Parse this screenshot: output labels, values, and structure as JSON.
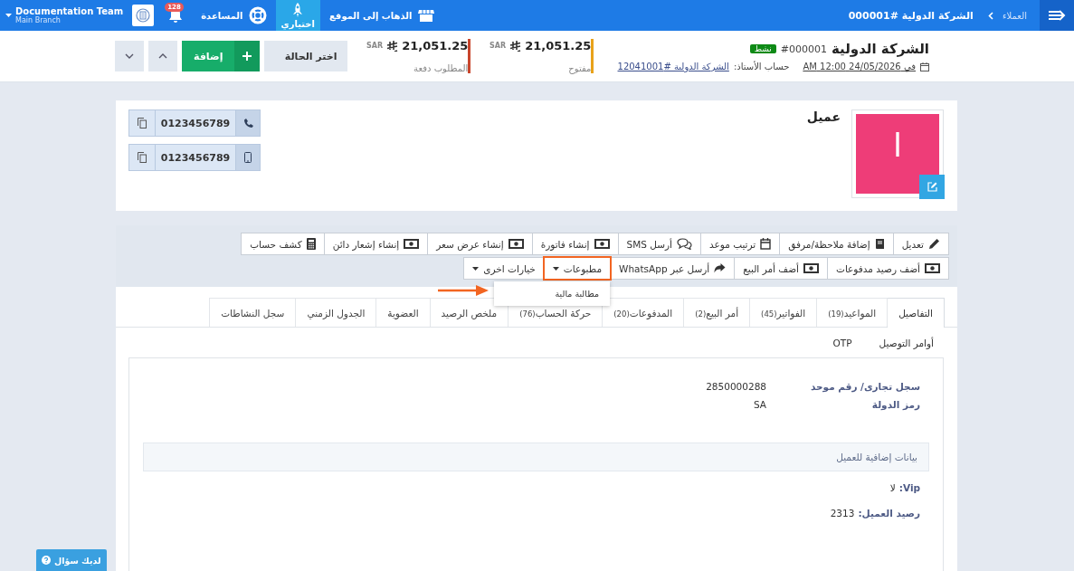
{
  "topbar": {
    "breadcrumb": [
      {
        "label": "العملاء"
      },
      {
        "label": "الشركة الدولية #000001"
      }
    ],
    "nav": [
      {
        "label": "الذهاب إلى الموقع",
        "kind": "store",
        "selected": false
      },
      {
        "label": "اختياري",
        "kind": "rocket",
        "selected": true
      },
      {
        "label": "المساعدة",
        "kind": "help",
        "selected": false
      }
    ],
    "notifications": "128",
    "account": {
      "name": "Documentation Team",
      "branch": "Main Branch"
    }
  },
  "header": {
    "title": "الشركة الدولية",
    "number": "#000001",
    "status": "نشط",
    "date": "في 24/05/2026 12:00 AM",
    "ledger_label": "حساب الأستاذ:",
    "ledger_link": "الشركة الدولية #12041001",
    "balances": [
      {
        "amount": "21,051.25",
        "currency": "SAR",
        "label": "مفتوح",
        "color": "#e8a21a"
      },
      {
        "amount": "21,051.25",
        "currency": "SAR",
        "label": "المطلوب دفعة",
        "color": "#c8452c"
      }
    ],
    "status_select": "اختر الحالة",
    "add_button": "إضافة"
  },
  "customer": {
    "avatar_letter": "ا",
    "name": "عميل",
    "phones": [
      {
        "kind": "phone",
        "number": "0123456789"
      },
      {
        "kind": "mobile",
        "number": "0123456789"
      }
    ]
  },
  "action_rows": [
    {
      "buttons": [
        {
          "label": "تعديل",
          "kind": "edit",
          "highlighted": false
        },
        {
          "label": "إضافة ملاحظة/مرفق",
          "kind": "note",
          "highlighted": false
        },
        {
          "label": "ترتيب موعد",
          "kind": "appointment",
          "highlighted": false
        },
        {
          "label": "أرسل SMS",
          "kind": "message",
          "highlighted": false
        },
        {
          "label": "إنشاء فاتورة",
          "kind": "document",
          "highlighted": false
        },
        {
          "label": "إنشاء عرض سعر",
          "kind": "document",
          "highlighted": false
        },
        {
          "label": "إنشاء إشعار دائن",
          "kind": "document",
          "highlighted": false
        },
        {
          "label": "كشف حساب",
          "kind": "statement",
          "highlighted": false
        }
      ]
    },
    {
      "buttons": [
        {
          "label": "أضف رصيد مدفوعات",
          "kind": "document",
          "highlighted": false
        },
        {
          "label": "أضف أمر البيع",
          "kind": "document",
          "highlighted": false
        },
        {
          "label": "أرسل عبر WhatsApp",
          "kind": "send",
          "highlighted": false
        },
        {
          "label": "مطبوعات",
          "kind": "dropdown",
          "highlighted": true,
          "menu": [
            "مطالبة مالية"
          ]
        },
        {
          "label": "خيارات اخرى",
          "kind": "dropdown",
          "highlighted": false
        }
      ]
    }
  ],
  "tabs": [
    {
      "label": "التفاصيل",
      "selected": true
    },
    {
      "label": "المواعيد",
      "count": "(19)",
      "selected": false
    },
    {
      "label": "الفواتير",
      "count": "(45)",
      "selected": false
    },
    {
      "label": "أمر البيع",
      "count": "(2)",
      "selected": false
    },
    {
      "label": "المدفوعات",
      "count": "(20)",
      "selected": false
    },
    {
      "label": "حركة الحساب",
      "count": "(76)",
      "selected": false
    },
    {
      "label": "ملخص الرصيد",
      "selected": false
    },
    {
      "label": "العضوية",
      "selected": false
    },
    {
      "label": "الجدول الزمني",
      "selected": false
    },
    {
      "label": "سجل النشاطات",
      "selected": false
    }
  ],
  "subtabs": [
    "أوامر التوصيل",
    "OTP"
  ],
  "details": [
    {
      "label": "سجل تجارى/ رقم موحد",
      "value": "2850000288"
    },
    {
      "label": "رمز الدولة",
      "value": "SA"
    }
  ],
  "extra_section": {
    "title": "بيانات إضافية للعميل",
    "fields": [
      {
        "label": "Vip:",
        "value": "لا"
      },
      {
        "label": "رصيد العميل:",
        "value": "2313"
      }
    ]
  },
  "help_button": "لديك سؤال"
}
